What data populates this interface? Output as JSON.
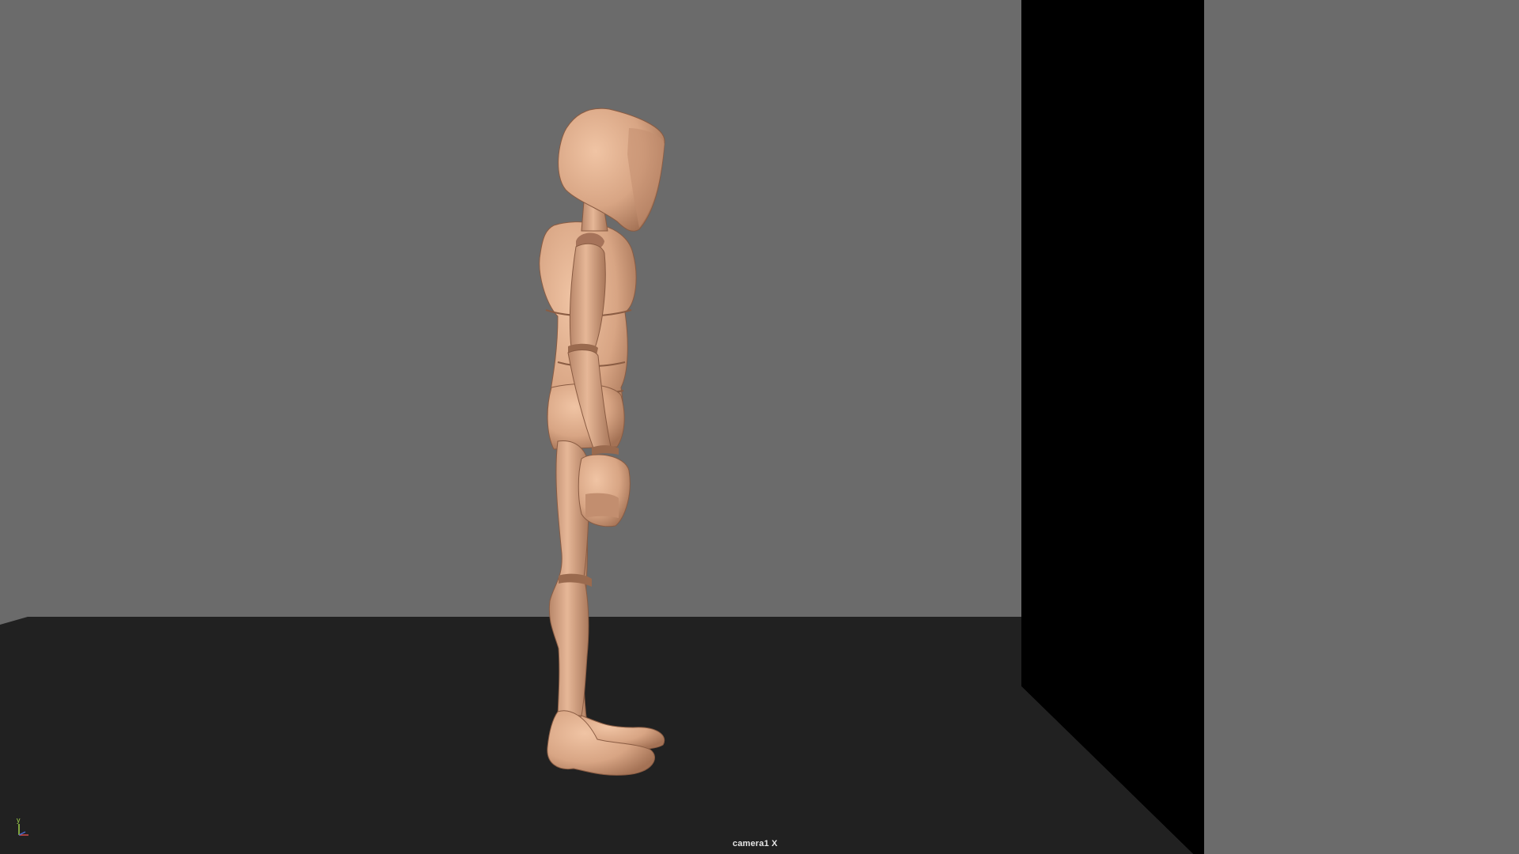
{
  "viewport": {
    "camera_label": "camera1 X",
    "background_color": "#6b6b6b",
    "floor_color": "#212121",
    "wall_color": "#000000",
    "side_panel_color": "#6b6b6b",
    "model_color": "#d8a584"
  },
  "axis_gizmo": {
    "y_label": "y",
    "y_color": "#9fd04a",
    "x_color": "#d04a4a",
    "z_color": "#4a6bd0"
  }
}
